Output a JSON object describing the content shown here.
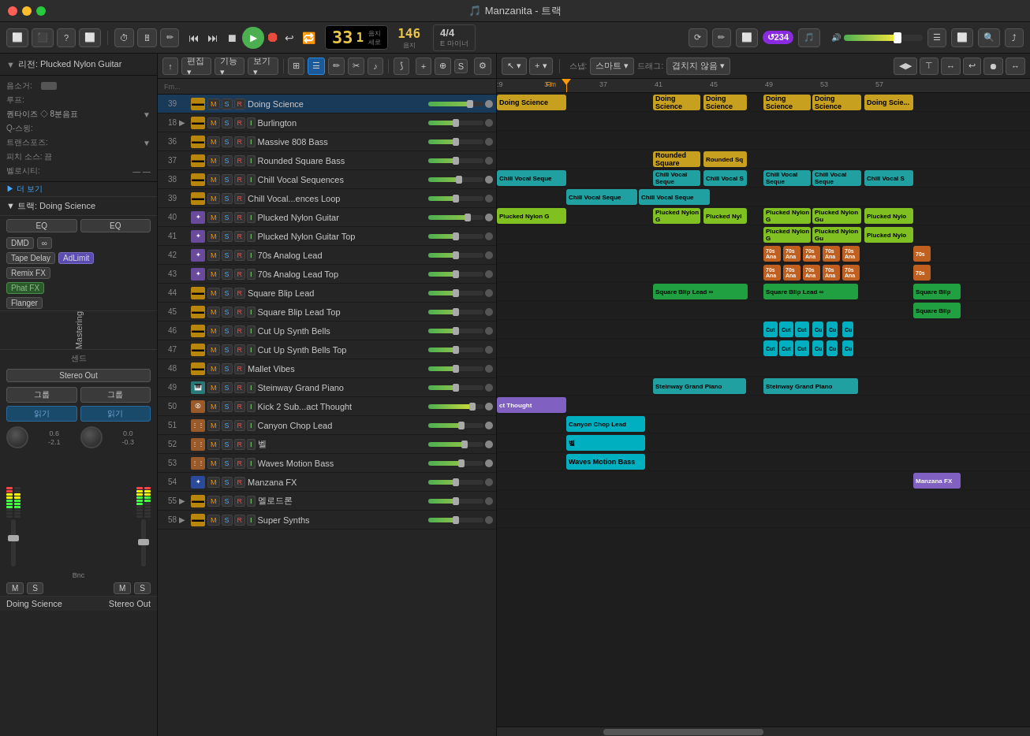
{
  "titlebar": {
    "title": "Manzanita - 트랙",
    "icon": "🎵"
  },
  "toolbar": {
    "display": {
      "bar": "33",
      "beat": "1",
      "bpm": "146",
      "bpm_label": "음지",
      "beat_label": "세로",
      "time_sig": "4/4",
      "key": "E 마이너"
    },
    "left_track_label": "리전: Plucked Nylon Guitar"
  },
  "tracks": [
    {
      "num": "39",
      "name": "Chill Vocal...ences Loop",
      "color": "yellow",
      "icon": "drum"
    },
    {
      "num": "40",
      "name": "Plucked Nylon Guitar",
      "color": "purple",
      "icon": "guitar"
    },
    {
      "num": "41",
      "name": "Plucked Nylon Guitar Top",
      "color": "purple",
      "icon": "guitar"
    },
    {
      "num": "42",
      "name": "70s Analog Lead",
      "color": "purple",
      "icon": "guitar"
    },
    {
      "num": "43",
      "name": "70s Analog Lead Top",
      "color": "purple",
      "icon": "guitar"
    },
    {
      "num": "44",
      "name": "Square Blip Lead",
      "color": "yellow",
      "icon": "drum"
    },
    {
      "num": "45",
      "name": "Square Blip Lead Top",
      "color": "yellow",
      "icon": "drum"
    },
    {
      "num": "46",
      "name": "Cut Up Synth Bells",
      "color": "yellow",
      "icon": "drum"
    },
    {
      "num": "47",
      "name": "Cut Up Synth Bells Top",
      "color": "yellow",
      "icon": "drum"
    },
    {
      "num": "48",
      "name": "Mallet Vibes",
      "color": "yellow",
      "icon": "drum"
    },
    {
      "num": "49",
      "name": "Steinway Grand Piano",
      "color": "teal",
      "icon": "piano"
    },
    {
      "num": "50",
      "name": "Kick 2 Sub...act Thought",
      "color": "orange",
      "icon": "kick"
    },
    {
      "num": "51",
      "name": "Canyon Chop Lead",
      "color": "orange",
      "icon": "synth"
    },
    {
      "num": "52",
      "name": "벨",
      "color": "orange",
      "icon": "synth"
    },
    {
      "num": "53",
      "name": "Waves Motion Bass",
      "color": "orange",
      "icon": "bass"
    },
    {
      "num": "54",
      "name": "Manzana FX",
      "color": "blue",
      "icon": "fx"
    },
    {
      "num": "55",
      "name": "멜로드론",
      "color": "yellow",
      "icon": "drum"
    },
    {
      "num": "58",
      "name": "Super Synths",
      "color": "yellow",
      "icon": "synth"
    }
  ],
  "all_tracks": [
    {
      "num": "39",
      "name": "Doing Science"
    },
    {
      "num": "18",
      "name": "Burlington"
    },
    {
      "num": "36",
      "name": "Massive 808 Bass"
    },
    {
      "num": "37",
      "name": "Rounded Square Bass"
    },
    {
      "num": "38",
      "name": "Chill Vocal Sequences"
    },
    {
      "num": "39",
      "name": "Chill Vocal...ences Loop"
    },
    {
      "num": "40",
      "name": "Plucked Nylon Guitar"
    },
    {
      "num": "41",
      "name": "Plucked Nylon Guitar Top"
    },
    {
      "num": "42",
      "name": "70s Analog Lead"
    },
    {
      "num": "43",
      "name": "70s Analog Lead Top"
    },
    {
      "num": "44",
      "name": "Square Blip Lead"
    },
    {
      "num": "45",
      "name": "Square Blip Lead Top"
    },
    {
      "num": "46",
      "name": "Cut Up Synth Bells"
    },
    {
      "num": "47",
      "name": "Cut Up Synth Bells Top"
    },
    {
      "num": "48",
      "name": "Mallet Vibes"
    },
    {
      "num": "49",
      "name": "Steinway Grand Piano"
    },
    {
      "num": "50",
      "name": "Kick 2 Sub...act Thought"
    },
    {
      "num": "51",
      "name": "Canyon Chop Lead"
    },
    {
      "num": "52",
      "name": "벨"
    },
    {
      "num": "53",
      "name": "Waves Motion Bass"
    },
    {
      "num": "54",
      "name": "Manzana FX"
    },
    {
      "num": "55",
      "name": "멜로드론"
    },
    {
      "num": "58",
      "name": "Super Synths"
    }
  ],
  "left_panel": {
    "region_label": "리전: Plucked Nylon Guitar",
    "source_label": "음소거:",
    "loop_label": "루프:",
    "quantize_label": "퀀타이즈 ◇ 8분음표",
    "qswing_label": "Q-스윙:",
    "transpose_label": "트랜스포즈:",
    "pitch_source_label": "피치 소스: 끔",
    "velocity_label": "벨로시티:",
    "more_label": "더 보기",
    "track_label": "트랙: Doing Science",
    "eq1": "EQ",
    "eq2": "EQ",
    "dmd": "DMD",
    "tape_delay": "Tape Delay",
    "remix_fx": "Remix FX",
    "phat_fx": "Phat FX",
    "flanger": "Flanger",
    "adlimit": "AdLimit",
    "mastering": "Mastering",
    "send_label": "센드",
    "stereo_out": "Stereo Out",
    "group1": "그룹",
    "group2": "그룹",
    "reading1": "읽기",
    "reading2": "읽기",
    "vol1": "0.6",
    "vol2": "-2.1",
    "vol3": "0.0",
    "vol4": "-0.3",
    "ms1": "M",
    "ms2": "S",
    "ms3": "M",
    "ms4": "S",
    "bnc": "Bnc",
    "track_bottom": "Doing Science",
    "stereo_bottom": "Stereo Out"
  },
  "doing_science_label": "Doing Science",
  "rounded_square_label": "Rounded Square",
  "waves_motion_bass_label": "Waves Motion Bass",
  "plucked_nylon_label": "Plucked Nylon",
  "mastering_label": "Mastering",
  "square_blip_label": "Square Blip Lead @"
}
